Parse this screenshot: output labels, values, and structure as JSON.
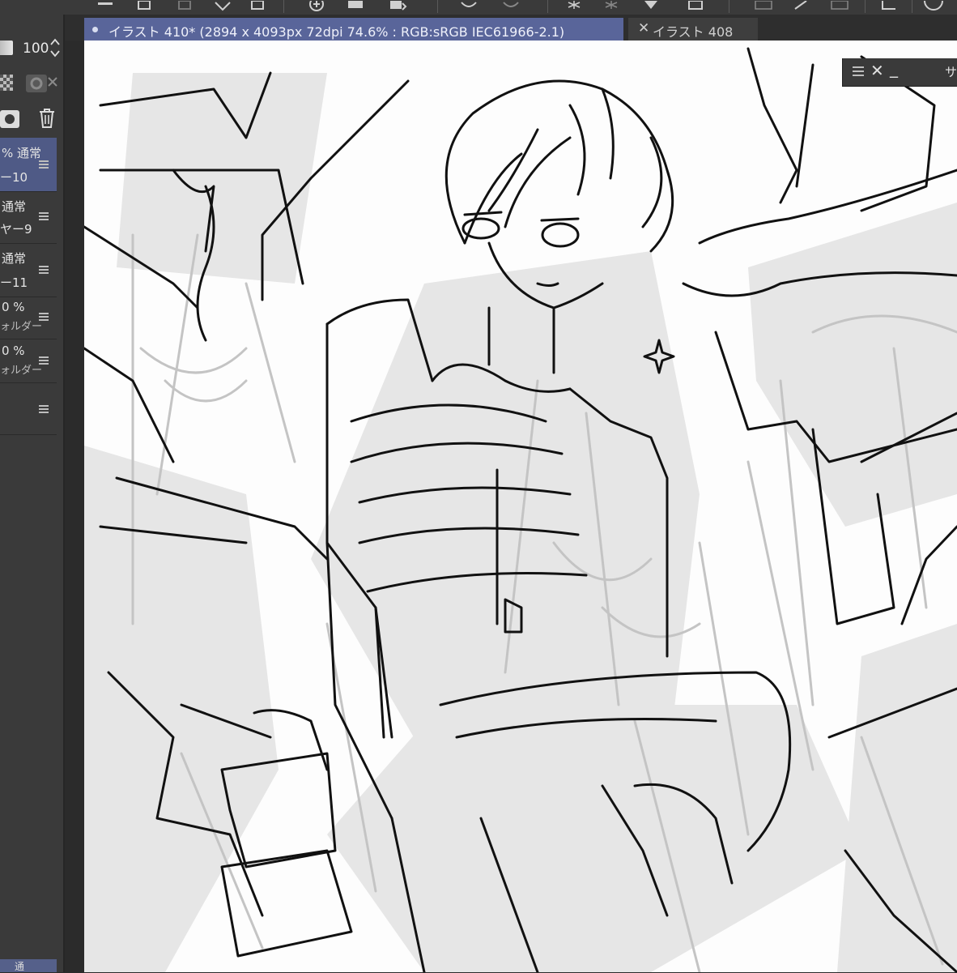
{
  "toolbar": {
    "icons": [
      "menu-icon",
      "copy-icon",
      "paste-icon",
      "fill-icon",
      "transform-icon",
      "layer-add-icon",
      "folder-icon",
      "select-icon",
      "undo-icon",
      "redo-icon",
      "sparkle-icon",
      "sparkle2-icon",
      "fill2-icon",
      "frame-icon",
      "grid-icon",
      "settings-icon",
      "fullscreen-icon",
      "view-icon"
    ]
  },
  "layer_panel": {
    "opacity_value": "100",
    "layers": [
      {
        "line1": "% 通常",
        "line2": "ー10",
        "selected": true
      },
      {
        "line1": "通常",
        "line2": "ヤー9",
        "selected": false
      },
      {
        "line1": "通常",
        "line2": "ー11",
        "selected": false
      },
      {
        "line1": "0 %",
        "line2": "ォルダー",
        "selected": false
      },
      {
        "line1": "0 %",
        "line2": "ォルダー",
        "selected": false
      },
      {
        "line1": "",
        "line2": "",
        "selected": false
      }
    ],
    "bottom_tab_label": "通"
  },
  "tabs": {
    "active_label": "イラスト 410* (2894 x 4093px 72dpi 74.6% : RGB:sRGB IEC61966-2.1)",
    "other_label": "イラスト 408",
    "close_glyph": "✕"
  },
  "float_palette": {
    "close_glyph": "✕",
    "minimize_glyph": "_",
    "label": "サ"
  },
  "colors": {
    "accent_tab": "#59659a",
    "panel_bg": "#3a3a3a",
    "canvas_bg": "#fdfdfd"
  }
}
